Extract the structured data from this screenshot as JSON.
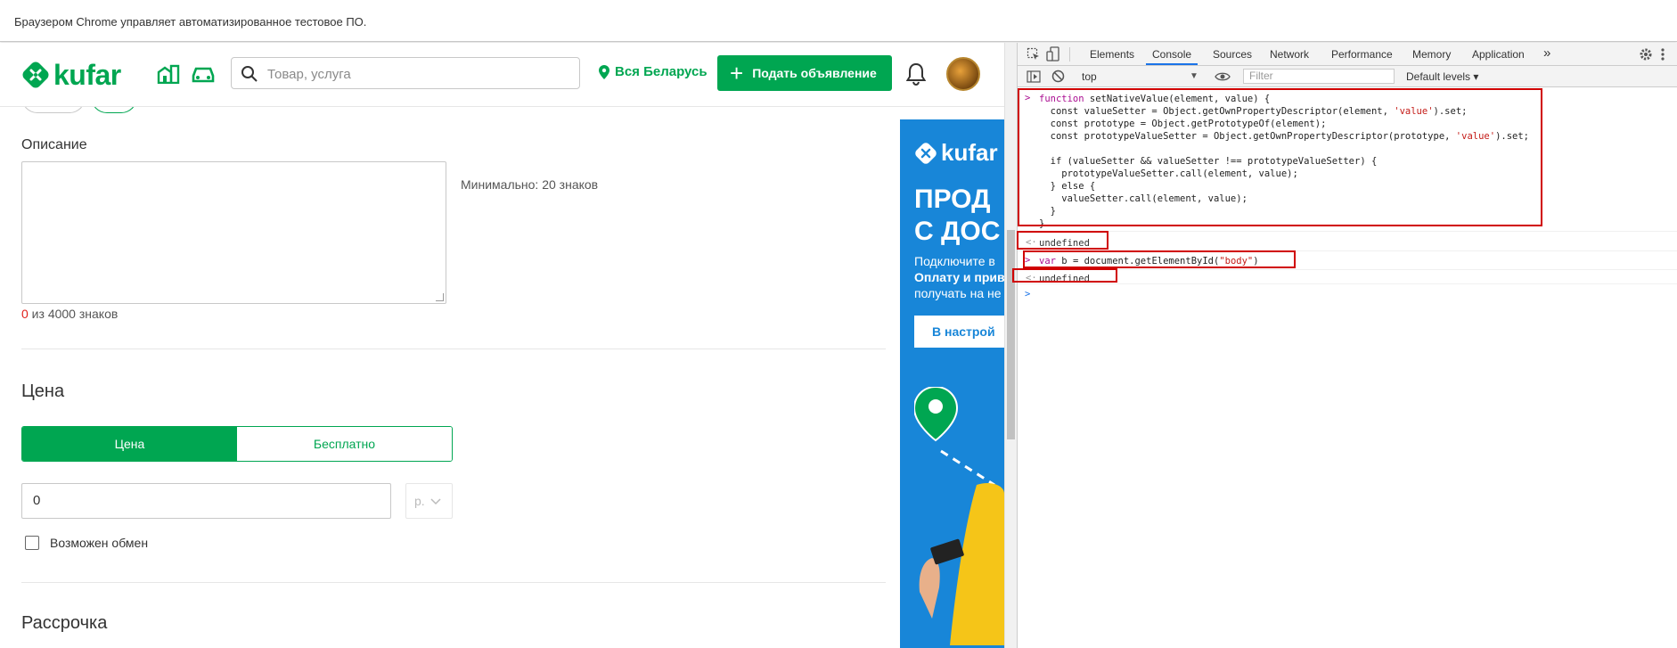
{
  "infobar": {
    "text": "Браузером Chrome управляет автоматизированное тестовое ПО."
  },
  "header": {
    "logo_text": "kufar",
    "search_placeholder": "Товар, услуга",
    "region": "Вся Беларусь",
    "post_button": "Подать объявление"
  },
  "form": {
    "description_label": "Описание",
    "description_hint": "Минимально: 20 знаков",
    "counter_value": "0",
    "counter_suffix": " из 4000 знаков",
    "price_heading": "Цена",
    "price_tabs": [
      "Цена",
      "Бесплатно"
    ],
    "price_value": "0",
    "currency": "р.",
    "exchange_label": "Возможен обмен",
    "installment_heading": "Рассрочка"
  },
  "banner": {
    "logo_text": "kufar",
    "headline_1": "ПРОД",
    "headline_2": "С ДОС",
    "text_1": "Подключите в",
    "text_2": "Оплату и прив",
    "text_3": "получать на не",
    "button": "В настрой"
  },
  "devtools": {
    "tabs": [
      "Elements",
      "Console",
      "Sources",
      "Network",
      "Performance",
      "Memory",
      "Application"
    ],
    "active_tab": "Console",
    "more": "»",
    "context": "top",
    "filter_placeholder": "Filter",
    "levels": "Default levels ▾",
    "console": {
      "line1_a": "function ",
      "line1_b": "setNativeValue(element, value) {",
      "line2": "  const valueSetter = Object.getOwnPropertyDescriptor(element, ",
      "line2_str": "'value'",
      "line2_end": ").set;",
      "line3": "  const prototype = Object.getPrototypeOf(element);",
      "line4": "  const prototypeValueSetter = Object.getOwnPropertyDescriptor(prototype, ",
      "line4_str": "'value'",
      "line4_end": ").set;",
      "line6": "  if (valueSetter && valueSetter !== prototypeValueSetter) {",
      "line7": "    prototypeValueSetter.call(element, value);",
      "line8": "  } else {",
      "line9": "    valueSetter.call(element, value);",
      "line10": "  }",
      "line11": "}",
      "result1": "undefined",
      "cmd2_kw": "var ",
      "cmd2": "b = document.getElementById(",
      "cmd2_str": "\"body\"",
      "cmd2_end": ")",
      "result2": "undefined"
    }
  },
  "colors": {
    "brand": "#00a651",
    "banner": "#1886d8",
    "highlight": "#d00000"
  }
}
